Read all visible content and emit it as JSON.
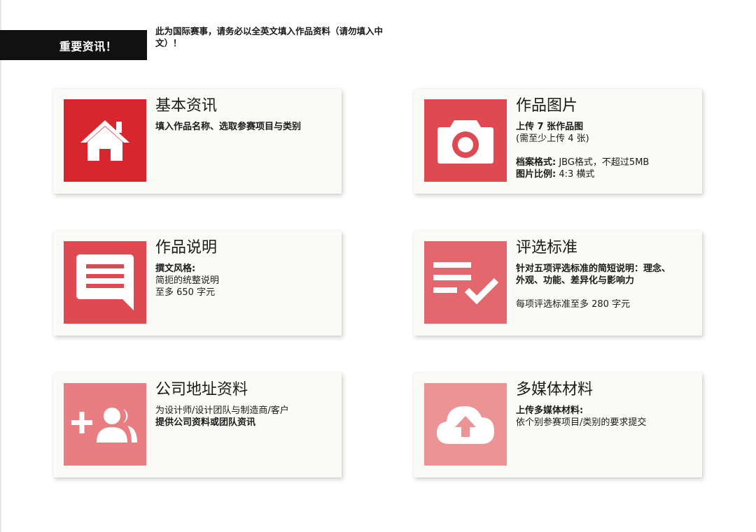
{
  "header": {
    "banner": "重要资讯！",
    "notice": "此为国际赛事，请务必以全英文填入作品资料（请勿填入中文）！"
  },
  "cards": [
    {
      "title": "基本资讯",
      "icon": "home-icon",
      "color": "#d7262e",
      "line1": "填入作品名称、选取参赛项目与类别"
    },
    {
      "title": "作品图片",
      "icon": "camera-icon",
      "color": "#df4a52",
      "line1": "上传 7 张作品图",
      "line2": "(需至少上传 4 张)",
      "line3_label": "档案格式:",
      "line3_value": " JBG格式，不超过5MB",
      "line4_label": "图片比例:",
      "line4_value": " 4:3 横式"
    },
    {
      "title": "作品说明",
      "icon": "comment-icon",
      "color": "#df4a52",
      "line1": "撰文风格:",
      "line2": "简扼的统整说明",
      "line3": "至多 650 字元"
    },
    {
      "title": "评选标准",
      "icon": "checklist-icon",
      "color": "#e4676d",
      "line1": "针对五项评选标准的简短说明：理念、",
      "line2": "外观、功能、差异化与影响力",
      "line3": "每项评选标准至多 280 字元"
    },
    {
      "title": "公司地址资料",
      "icon": "add-group-icon",
      "color": "#e87e82",
      "line1": "为设计师/设计团队与制造商/客户",
      "line2": "提供公司资料或团队资讯"
    },
    {
      "title": "多媒体材料",
      "icon": "cloud-upload-icon",
      "color": "#ec9396",
      "line1": "上传多媒体材料:",
      "line2": "依个别参赛项目/类别的要求提交"
    }
  ]
}
